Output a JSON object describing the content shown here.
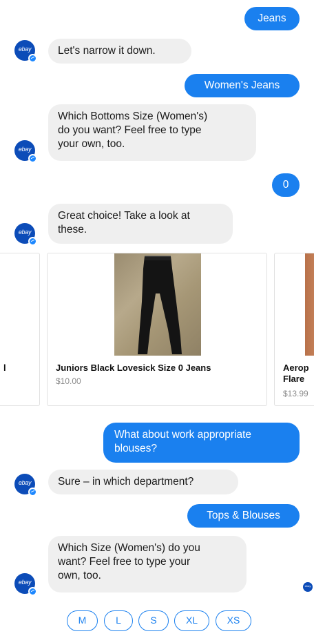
{
  "colors": {
    "accent": "#1a80ef",
    "incoming_bg": "#efefef",
    "brand": "#0c4cb8"
  },
  "avatar": {
    "text": "ebay",
    "badge_icon": "messenger-icon"
  },
  "messages": {
    "m1": "Jeans",
    "m2": "Let's narrow it down.",
    "m3": "Women's Jeans",
    "m4_l1": "Which Bottoms Size (Women's)",
    "m4_l2": "do you want?  Feel free to type",
    "m4_l3": "your own, too.",
    "m5": "0",
    "m6_l1": "Great choice! Take a look at",
    "m6_l2": "these.",
    "m7_l1": "What about work appropriate",
    "m7_l2": "blouses?",
    "m8": "Sure – in which department?",
    "m9": "Tops & Blouses",
    "m10_l1": "Which Size (Women's) do you",
    "m10_l2": "want?  Feel free to type your",
    "m10_l3": "own, too."
  },
  "carousel": {
    "prev_fragment": "l",
    "items": [
      {
        "title": "Juniors Black Lovesick Size 0 Jeans",
        "price": "$10.00"
      },
      {
        "title_l1": "Aerop",
        "title_l2": "Flare",
        "price": "$13.99"
      }
    ]
  },
  "typing_avatar": "ebay",
  "quick_replies": [
    "M",
    "L",
    "S",
    "XL",
    "XS"
  ]
}
